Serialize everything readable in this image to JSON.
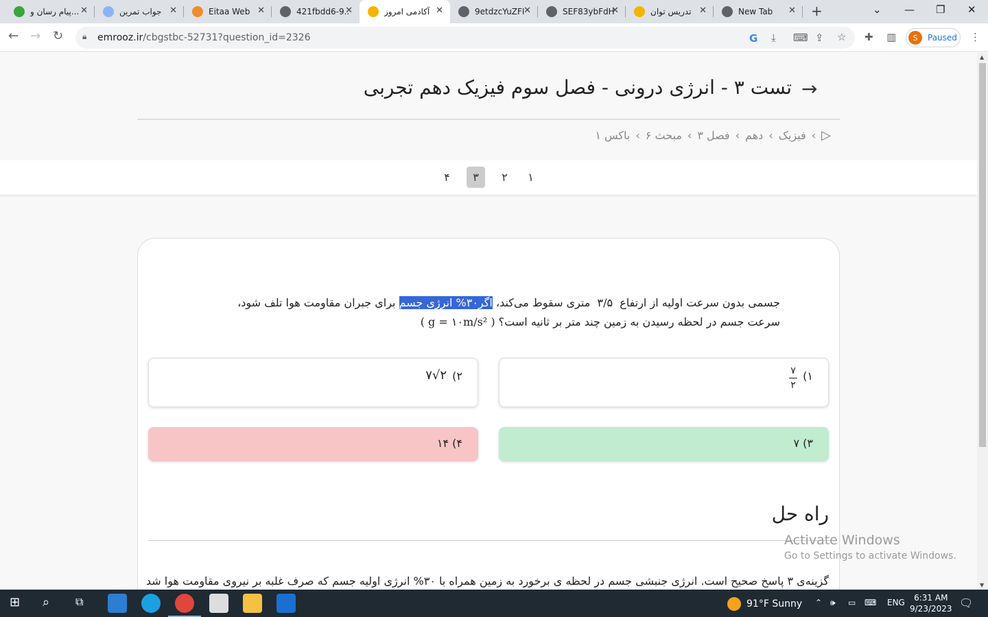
{
  "browser": {
    "tabs": [
      {
        "title": "پیام رسان و...",
        "favicon_color": "#3aa53a",
        "active": false
      },
      {
        "title": "جواب تمرین",
        "favicon_color": "#8ab4f8",
        "active": false
      },
      {
        "title": "Eitaa Web",
        "favicon_color": "#f28b2a",
        "active": false
      },
      {
        "title": "421fbdd6-9...",
        "favicon_color": "#5f6368",
        "active": false
      },
      {
        "title": "آکادمی امروز",
        "favicon_color": "#f4b400",
        "active": true
      },
      {
        "title": "9etdzcYuZFI",
        "favicon_color": "#5f6368",
        "active": false
      },
      {
        "title": "SEF83ybFdH",
        "favicon_color": "#5f6368",
        "active": false
      },
      {
        "title": "تدریس توان",
        "favicon_color": "#f4b400",
        "active": false
      },
      {
        "title": "New Tab",
        "favicon_color": "#5f6368",
        "active": false
      }
    ],
    "url_host": "emrooz.ir",
    "url_path": "/cbgstbc-52731?question_id=2326",
    "profile_letter": "S",
    "profile_status": "Paused"
  },
  "page": {
    "title": "تست ۳ - انرژی درونی - فصل سوم فیزیک دهم تجربی",
    "breadcrumbs": [
      "فیزیک",
      "دهم",
      "فصل ۳",
      "مبحث ۶",
      "باکس ۱"
    ],
    "pager": {
      "pages": [
        "۱",
        "۲",
        "۳",
        "۴"
      ],
      "current": "۳"
    },
    "question": {
      "part1": "جسمی بدون سرعت اولیه از ارتفاع",
      "height_value": "۳/۵",
      "part2": "متری سقوط می‌کند،",
      "highlight": "اگر۳۰% انرژی جسم",
      "part3": "برای جبران مقاومت هوا تلف شود، سرعت جسم در لحظه رسیدن به زمین چند متر بر ثانیه است؟",
      "given": "( g = ۱۰m/s² )"
    },
    "options": {
      "opt1": {
        "label": "۱)",
        "num": "۷",
        "den": "۲"
      },
      "opt2": {
        "label": "۲)",
        "expr": "۷√۲"
      },
      "opt3": {
        "label": "۳) ۷"
      },
      "opt4": {
        "label": "۴) ۱۴"
      }
    },
    "solution_title": "راه حل",
    "solution_text": "گزینه‌ی ۳ پاسخ صحیح است. انرژی جنبشی جسم در لحظه ی برخورد به زمین همراه با ۳۰% انرژی اولیه جسم که صرف غلبه بر نیروی مقاومت هوا شده است"
  },
  "watermark": {
    "line1": "Activate Windows",
    "line2": "Go to Settings to activate Windows."
  },
  "taskbar": {
    "weather": "91°F  Sunny",
    "lang": "ENG",
    "time": "6:31 AM",
    "date": "9/23/2023"
  },
  "colors": {
    "correct": "#c1ecd0",
    "wrong": "#f7c5c6",
    "highlight": "#3567d8"
  }
}
